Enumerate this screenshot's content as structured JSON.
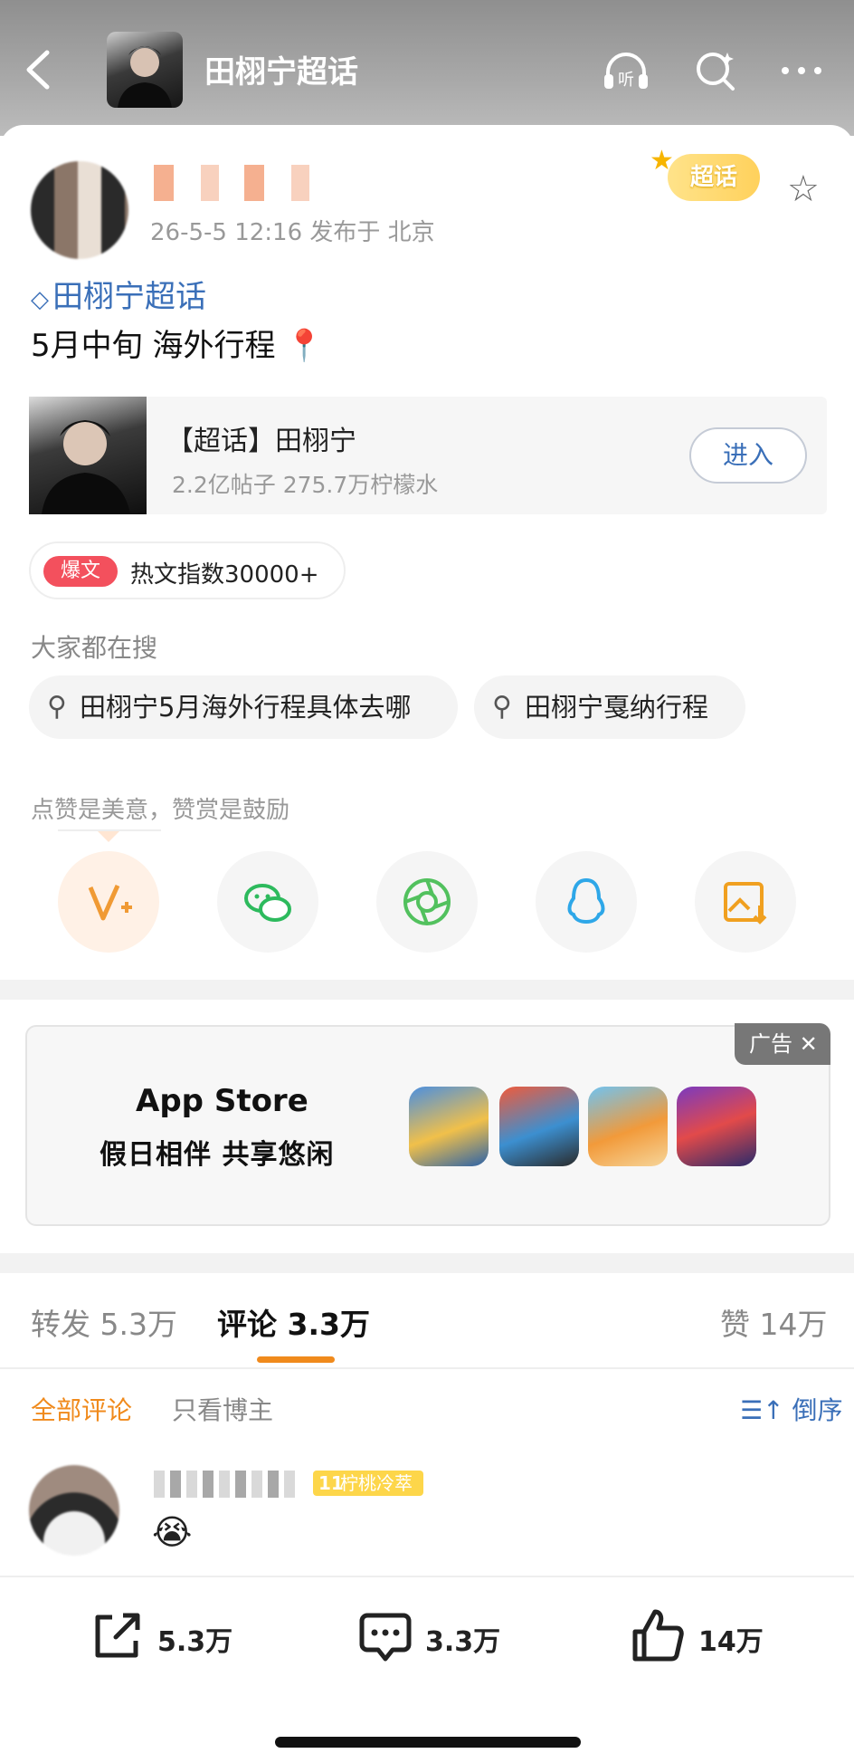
{
  "header": {
    "title": "田栩宁超话"
  },
  "post": {
    "time_location": "26-5-5 12:16  发布于 北京",
    "topic_link": "田栩宁超话",
    "text": "5月中旬 海外行程",
    "chaohua_badge": "超话"
  },
  "topic_card": {
    "name": "【超话】田栩宁",
    "stats": "2.2亿帖子  275.7万柠檬水",
    "enter_label": "进入"
  },
  "hot": {
    "tag": "爆文",
    "text": "热文指数30000+"
  },
  "search": {
    "heading": "大家都在搜",
    "chips": [
      "田栩宁5月海外行程具体去哪",
      "田栩宁戛纳行程"
    ]
  },
  "encourage_text": "点赞是美意，赞赏是鼓励",
  "share_targets": [
    "reward-icon",
    "wechat-icon",
    "moments-icon",
    "qq-icon",
    "save-image-icon"
  ],
  "ad": {
    "tag": "广告",
    "brand": "App Store",
    "slogan": "假日相伴 共享悠闲"
  },
  "stats_tabs": {
    "repost": "转发 5.3万",
    "comments": "评论 3.3万",
    "likes": "赞 14万"
  },
  "comment_filters": {
    "all": "全部评论",
    "author_only": "只看博主",
    "sort": "倒序"
  },
  "comment": {
    "badge": "柠桃冷萃",
    "level": "11",
    "emoji": "😭"
  },
  "actions": {
    "repost": "5.3万",
    "comment": "3.3万",
    "like": "14万"
  },
  "colors": {
    "accent": "#f08a1c",
    "link": "#3a6fb8",
    "hot": "#f3505d"
  }
}
